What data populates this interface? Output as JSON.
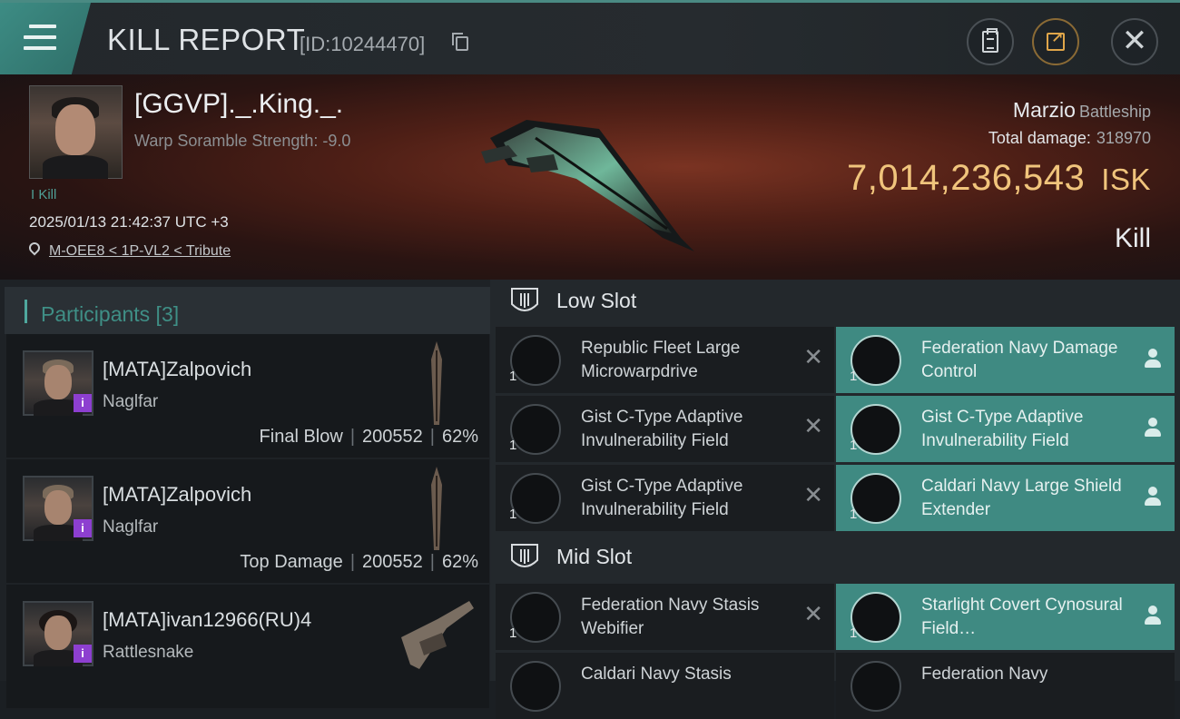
{
  "header": {
    "title": "KILL REPORT",
    "report_id": "[ID:10244470]"
  },
  "victim": {
    "name": "[GGVP]._.King._.",
    "warp_scramble": "Warp Soramble Strength: -9.0",
    "kill_tag": "Kill",
    "timestamp": "2025/01/13 21:42:37 UTC +3",
    "location": "M-OEE8 < 1P-VL2 < Tribute",
    "ship_name": "Marzio",
    "ship_class": "Battleship",
    "total_damage_label": "Total damage:",
    "total_damage": "318970",
    "isk_value": "7,014,236,543",
    "isk_unit": "ISK",
    "result": "Kill"
  },
  "participants": {
    "label": "Participants [3]",
    "items": [
      {
        "name": "[MATA]Zalpovich",
        "ship": "Naglfar",
        "role": "Final Blow",
        "damage": "200552",
        "percent": "62%",
        "badge": "i"
      },
      {
        "name": "[MATA]Zalpovich",
        "ship": "Naglfar",
        "role": "Top Damage",
        "damage": "200552",
        "percent": "62%",
        "badge": "i"
      },
      {
        "name": "[MATA]ivan12966(RU)4",
        "ship": "Rattlesnake",
        "badge": "i"
      }
    ]
  },
  "slots": {
    "low": {
      "label": "Low Slot",
      "modules": [
        {
          "name": "Republic Fleet Large Microwarpdrive",
          "qty": "1",
          "state": "destroyed"
        },
        {
          "name": "Federation Navy Damage Control",
          "qty": "1",
          "state": "dropped"
        },
        {
          "name": "Gist C-Type Adaptive Invulnerability Field",
          "qty": "1",
          "state": "destroyed"
        },
        {
          "name": "Gist C-Type Adaptive Invulnerability Field",
          "qty": "1",
          "state": "dropped"
        },
        {
          "name": "Gist C-Type Adaptive Invulnerability Field",
          "qty": "1",
          "state": "destroyed"
        },
        {
          "name": "Caldari Navy Large Shield Extender",
          "qty": "1",
          "state": "dropped"
        }
      ]
    },
    "mid": {
      "label": "Mid Slot",
      "modules": [
        {
          "name": "Federation Navy Stasis Webifier",
          "qty": "1",
          "state": "destroyed"
        },
        {
          "name": "Starlight Covert Cynosural Field…",
          "qty": "1",
          "state": "dropped"
        },
        {
          "name": "Caldari Navy Stasis",
          "qty": "1",
          "state": "destroyed"
        },
        {
          "name": "Federation Navy",
          "qty": "1",
          "state": "dropped"
        }
      ]
    }
  },
  "colors": {
    "accent": "#3f8a82",
    "isk": "#f0c47c",
    "badge": "#8d3fd0"
  }
}
